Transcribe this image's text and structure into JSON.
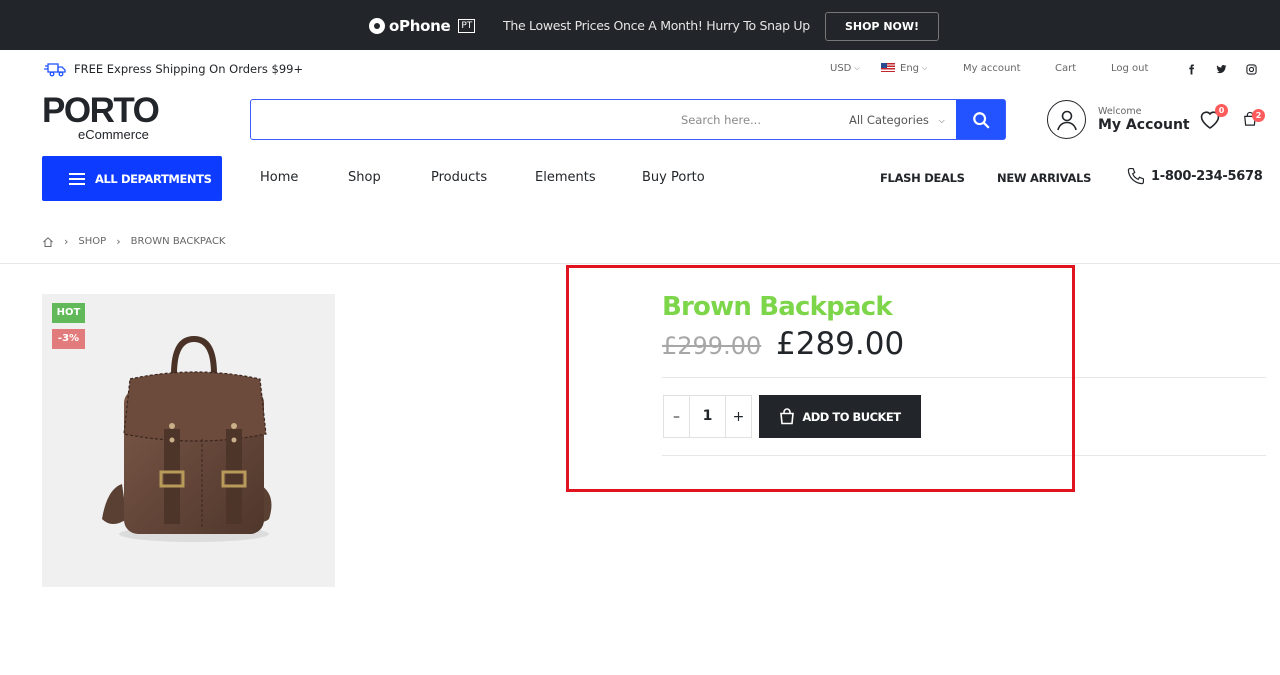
{
  "promo": {
    "brand": "oPhone",
    "brand_badge": "PT",
    "message": "The Lowest Prices Once A Month! Hurry To Snap Up",
    "cta": "SHOP NOW!"
  },
  "utility": {
    "shipping_text": "FREE Express Shipping On Orders $99+",
    "currency": "USD",
    "language": "Eng",
    "my_account": "My account",
    "cart": "Cart",
    "log_out": "Log out",
    "social": [
      "facebook-icon",
      "twitter-icon",
      "instagram-icon"
    ]
  },
  "header": {
    "logo_main": "PORTO",
    "logo_sub": "eCommerce",
    "search_placeholder": "Search here...",
    "search_category": "All Categories",
    "welcome": "Welcome",
    "account_name": "My Account",
    "wishlist_count": "0",
    "cart_count": "2"
  },
  "nav": {
    "departments": "ALL DEPARTMENTS",
    "links": [
      "Home",
      "Shop",
      "Products",
      "Elements",
      "Buy Porto"
    ],
    "flash_deals": "FLASH DEALS",
    "new_arrivals": "NEW ARRIVALS",
    "phone": "1-800-234-5678"
  },
  "breadcrumb": {
    "items": [
      "SHOP",
      "BROWN BACKPACK"
    ]
  },
  "product": {
    "tag_hot": "HOT",
    "tag_sale": "-3%",
    "title": "Brown Backpack",
    "old_price": "£299.00",
    "price": "£289.00",
    "quantity": "1",
    "minus": "–",
    "plus": "+",
    "add_label": "ADD TO BUCKET"
  },
  "colors": {
    "accent_blue": "#0d3bff",
    "title_green": "#7dd54a",
    "highlight_red": "#e0141e",
    "dark": "#222529"
  }
}
